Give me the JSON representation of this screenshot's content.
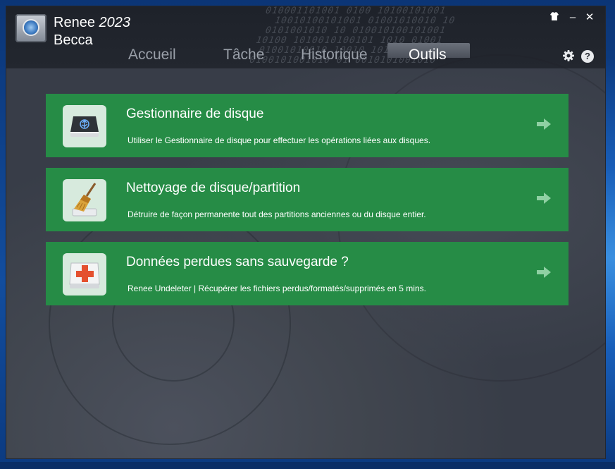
{
  "app": {
    "name": "Renee",
    "version": "2023",
    "user": "Becca"
  },
  "nav": {
    "tabs": [
      {
        "label": "Accueil",
        "active": false
      },
      {
        "label": "Tâche",
        "active": false
      },
      {
        "label": "Historique",
        "active": false
      },
      {
        "label": "Outils",
        "active": true
      }
    ]
  },
  "window_controls": {
    "skin_icon": "shirt-icon",
    "minimize": "–",
    "close": "✕",
    "settings_icon": "gear-icon",
    "help": "?"
  },
  "tools": [
    {
      "title": "Gestionnaire de disque",
      "description": "Utiliser le Gestionnaire de disque pour effectuer les opérations liées aux disques.",
      "icon": "disk-drive-icon"
    },
    {
      "title": "Nettoyage de disque/partition",
      "description": "Détruire de façon permanente tout des partitions anciennes ou du disque entier.",
      "icon": "broom-icon"
    },
    {
      "title": "Données perdues sans sauvegarde ?",
      "description": "Renee Undeleter | Récupérer les fichiers perdus/formatés/supprimés en 5 mins.",
      "icon": "first-aid-icon"
    }
  ],
  "colors": {
    "card_green": "#268c46",
    "window_bg": "#3a3f4b",
    "header_bg": "#1e222a",
    "desktop_blue": "#0d3f86"
  }
}
